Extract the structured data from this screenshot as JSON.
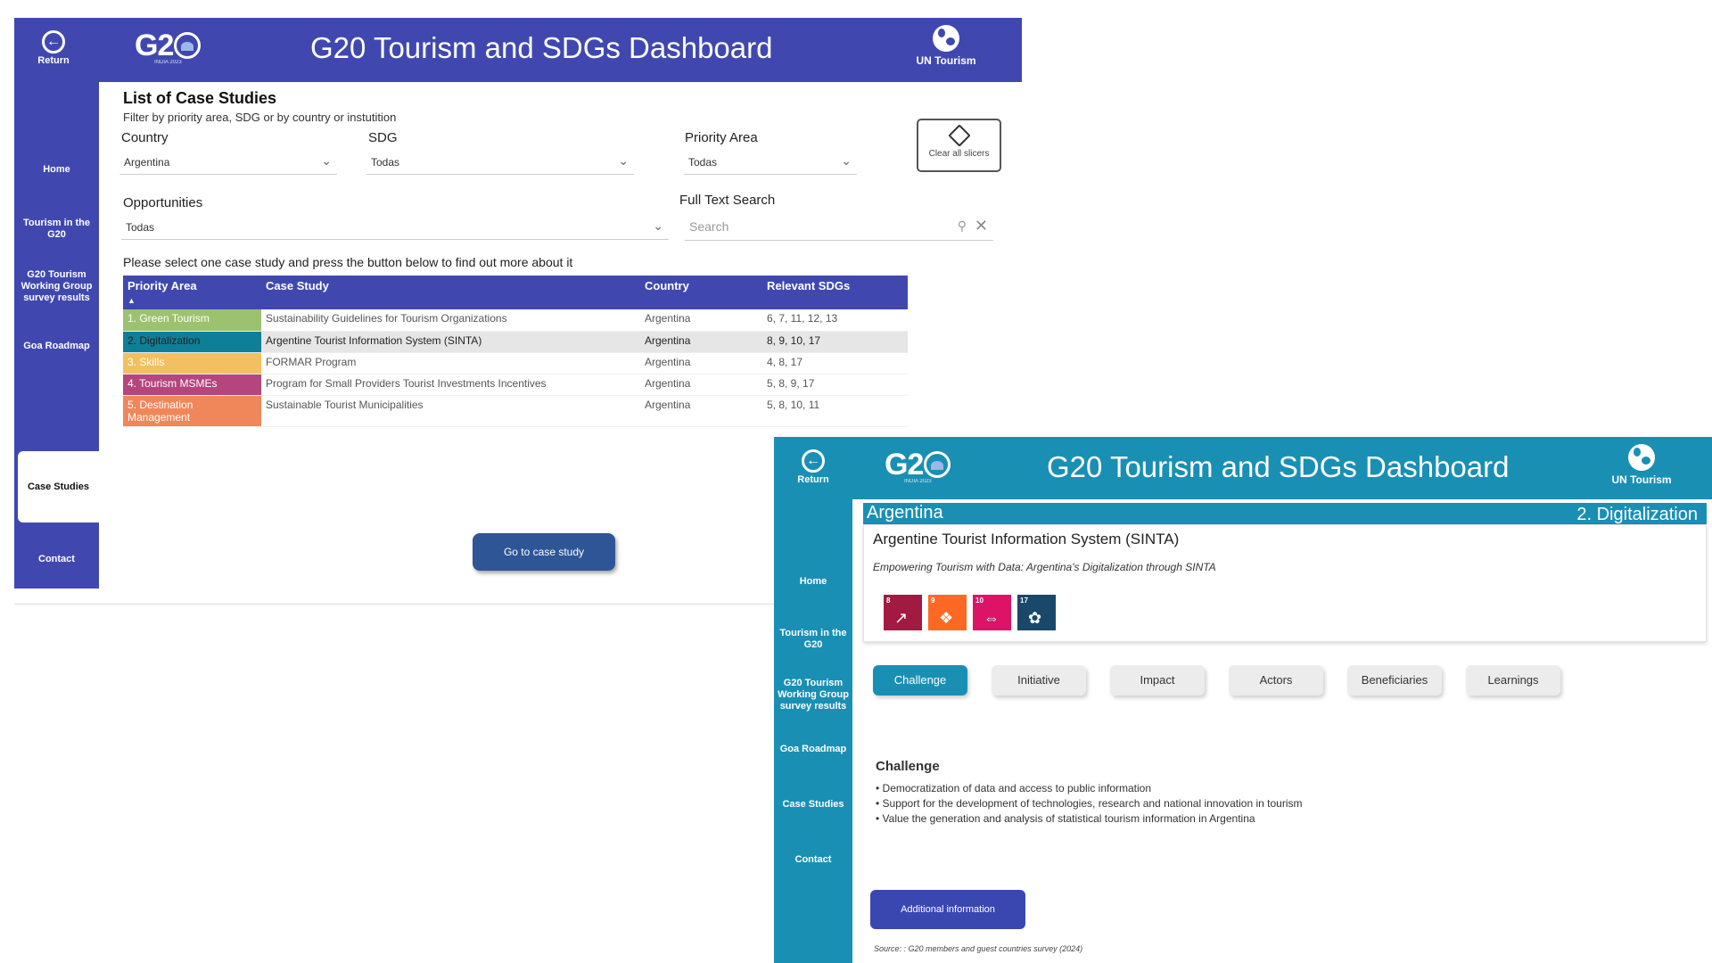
{
  "panel1": {
    "header": {
      "return_label": "Return",
      "logo_text": "G20",
      "logo_tagline": "INDIA 2023",
      "title": "G20 Tourism and SDGs Dashboard",
      "org_label": "UN Tourism"
    },
    "nav": [
      "Home",
      "Tourism in the G20",
      "G20 Tourism Working Group survey results",
      "Goa Roadmap",
      "Case Studies",
      "Contact"
    ],
    "active_nav": "Case Studies",
    "page_title": "List of Case Studies",
    "subtitle": "Filter by priority area, SDG or by country or instutition",
    "filters": {
      "country_label": "Country",
      "country_value": "Argentina",
      "sdg_label": "SDG",
      "sdg_value": "Todas",
      "priority_label": "Priority Area",
      "priority_value": "Todas",
      "clear_label": "Clear all slicers",
      "opportunities_label": "Opportunities",
      "opportunities_value": "Todas",
      "search_label": "Full Text Search",
      "search_placeholder": "Search"
    },
    "instruction": "Please select one case study and press the button below to find out more about it",
    "table": {
      "headers": [
        "Priority Area",
        "Case Study",
        "Country",
        "Relevant SDGs"
      ],
      "rows": [
        {
          "priority": "1. Green Tourism",
          "color": "#9dc26f",
          "case": "Sustainability Guidelines for Tourism Organizations",
          "country": "Argentina",
          "sdgs": "6, 7, 11, 12, 13"
        },
        {
          "priority": "2. Digitalization",
          "color": "#0f7f97",
          "case": "Argentine Tourist Information System (SINTA)",
          "country": "Argentina",
          "sdgs": "8, 9, 10, 17"
        },
        {
          "priority": "3. Skills",
          "color": "#f2c063",
          "case": "FORMAR Program",
          "country": "Argentina",
          "sdgs": "4, 8, 17"
        },
        {
          "priority": "4. Tourism MSMEs",
          "color": "#b5457e",
          "case": "Program for Small Providers Tourist Investments Incentives",
          "country": "Argentina",
          "sdgs": "5, 8, 9, 17"
        },
        {
          "priority": "5. Destination Management",
          "color": "#f0875a",
          "case": "Sustainable Tourist Municipalities",
          "country": "Argentina",
          "sdgs": "5, 8, 10, 11"
        }
      ]
    },
    "go_button": "Go to case study"
  },
  "panel2": {
    "header": {
      "return_label": "Return",
      "logo_text": "G20",
      "logo_tagline": "INDIA 2023",
      "title": "G20 Tourism and SDGs Dashboard",
      "org_label": "UN Tourism"
    },
    "nav": [
      "Home",
      "Tourism in the G20",
      "G20 Tourism Working Group survey results",
      "Goa Roadmap",
      "Case Studies",
      "Contact"
    ],
    "country": "Argentina",
    "priority": "2. Digitalization",
    "case_title": "Argentine Tourist Information System (SINTA)",
    "case_subtitle": "Empowering Tourism with Data: Argentina's Digitalization through SINTA",
    "sdg_icons": [
      {
        "num": "8",
        "color": "#a21942",
        "icon": "↗"
      },
      {
        "num": "9",
        "color": "#fd6925",
        "icon": "❖"
      },
      {
        "num": "10",
        "color": "#dd1367",
        "icon": "⇔"
      },
      {
        "num": "17",
        "color": "#19486a",
        "icon": "✿"
      }
    ],
    "tabs": [
      "Challenge",
      "Initiative",
      "Impact",
      "Actors",
      "Beneficiaries",
      "Learnings"
    ],
    "active_tab": "Challenge",
    "section_title": "Challenge",
    "bullets": [
      "• Democratization of data and access to public information",
      "• Support for the development of technologies, research and national innovation in tourism",
      "• Value the generation and analysis of statistical tourism information in Argentina"
    ],
    "additional_button": "Additional information",
    "source": "Source: : G20 members and guest countries survey (2024)"
  }
}
